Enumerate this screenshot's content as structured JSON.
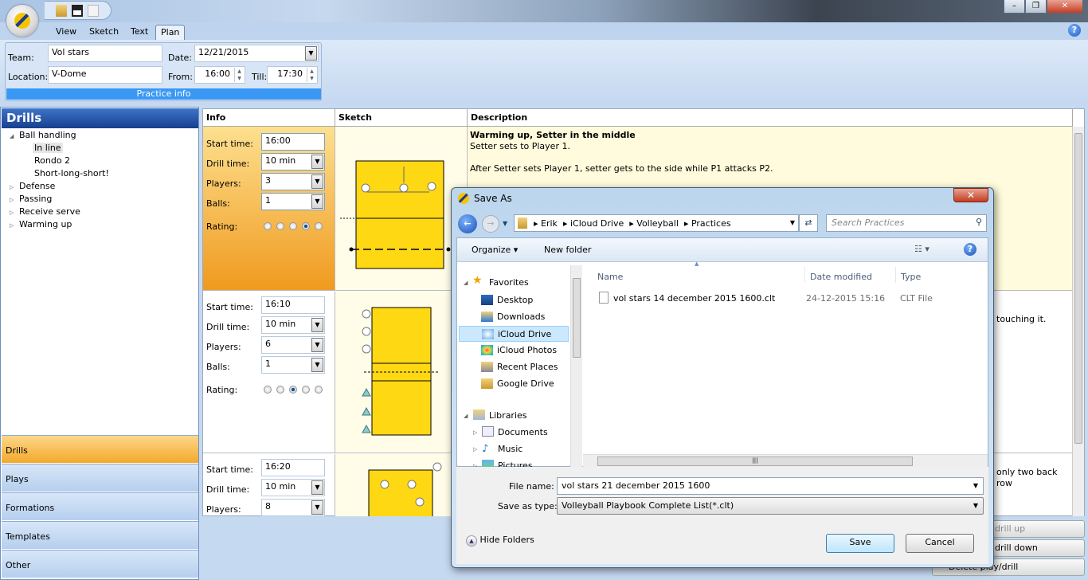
{
  "app": {
    "tabs": [
      "View",
      "Sketch",
      "Text",
      "Plan"
    ],
    "active_tab": "Plan",
    "window_controls": [
      "minimize",
      "restore",
      "close"
    ],
    "help": "?"
  },
  "practice_info": {
    "team_label": "Team:",
    "team": "Vol stars",
    "location_label": "Location:",
    "location": "V-Dome",
    "date_label": "Date:",
    "date": "12/21/2015",
    "from_label": "From:",
    "from": "16:00",
    "till_label": "Till:",
    "till": "17:30",
    "group_label": "Practice info"
  },
  "sidebar": {
    "title": "Drills",
    "tree": [
      {
        "label": "Ball handling",
        "expanded": true,
        "children": [
          "In line",
          "Rondo 2",
          "Short-long-short!"
        ]
      },
      {
        "label": "Defense"
      },
      {
        "label": "Passing"
      },
      {
        "label": "Receive serve"
      },
      {
        "label": "Warming up"
      }
    ],
    "selected": "In line",
    "nav": [
      "Drills",
      "Plays",
      "Formations",
      "Templates",
      "Other"
    ],
    "active_nav": "Drills"
  },
  "grid": {
    "headers": [
      "Info",
      "Sketch",
      "Description"
    ],
    "labels": {
      "start": "Start time:",
      "drill": "Drill time:",
      "players": "Players:",
      "balls": "Balls:",
      "rating": "Rating:"
    },
    "rows": [
      {
        "start": "16:00",
        "drill_time": "10 min",
        "players": "3",
        "balls": "1",
        "rating": 4,
        "title": "Warming up, Setter in the middle",
        "lines": [
          "Setter sets to Player 1.",
          "",
          "After Setter sets Player 1, setter gets to the side while P1 attacks P2."
        ]
      },
      {
        "start": "16:10",
        "drill_time": "10 min",
        "players": "6",
        "balls": "1",
        "rating": 3,
        "visible_text": "touching it."
      },
      {
        "start": "16:20",
        "drill_time": "10 min",
        "players": "8",
        "visible_text": "only two back row"
      }
    ]
  },
  "buttons": {
    "up": "drill up",
    "down": "drill down",
    "delete": "Delete play/drill"
  },
  "dialog": {
    "title": "Save As",
    "breadcrumb": [
      "Erik",
      "iCloud Drive",
      "Volleyball",
      "Practices"
    ],
    "search_placeholder": "Search Practices",
    "organize": "Organize",
    "new_folder": "New folder",
    "nav": {
      "favorites": "Favorites",
      "fav_items": [
        "Desktop",
        "Downloads",
        "iCloud Drive",
        "iCloud Photos",
        "Recent Places",
        "Google Drive"
      ],
      "libraries": "Libraries",
      "lib_items": [
        "Documents",
        "Music",
        "Pictures"
      ]
    },
    "selected_nav": "iCloud Drive",
    "columns": [
      "Name",
      "Date modified",
      "Type"
    ],
    "files": [
      {
        "name": "vol stars 14 december 2015 1600.clt",
        "date": "24-12-2015 15:16",
        "type": "CLT File"
      }
    ],
    "file_name_label": "File name:",
    "file_name": "vol stars 21 december 2015 1600",
    "type_label": "Save as type:",
    "type": "Volleyball Playbook Complete List(*.clt)",
    "hide_folders": "Hide Folders",
    "save": "Save",
    "cancel": "Cancel"
  },
  "colors": {
    "accent": "#3a98f5",
    "active_row": "#f4a92a",
    "court": "#ffd814",
    "sidebar_header": "#1f4fa3"
  }
}
